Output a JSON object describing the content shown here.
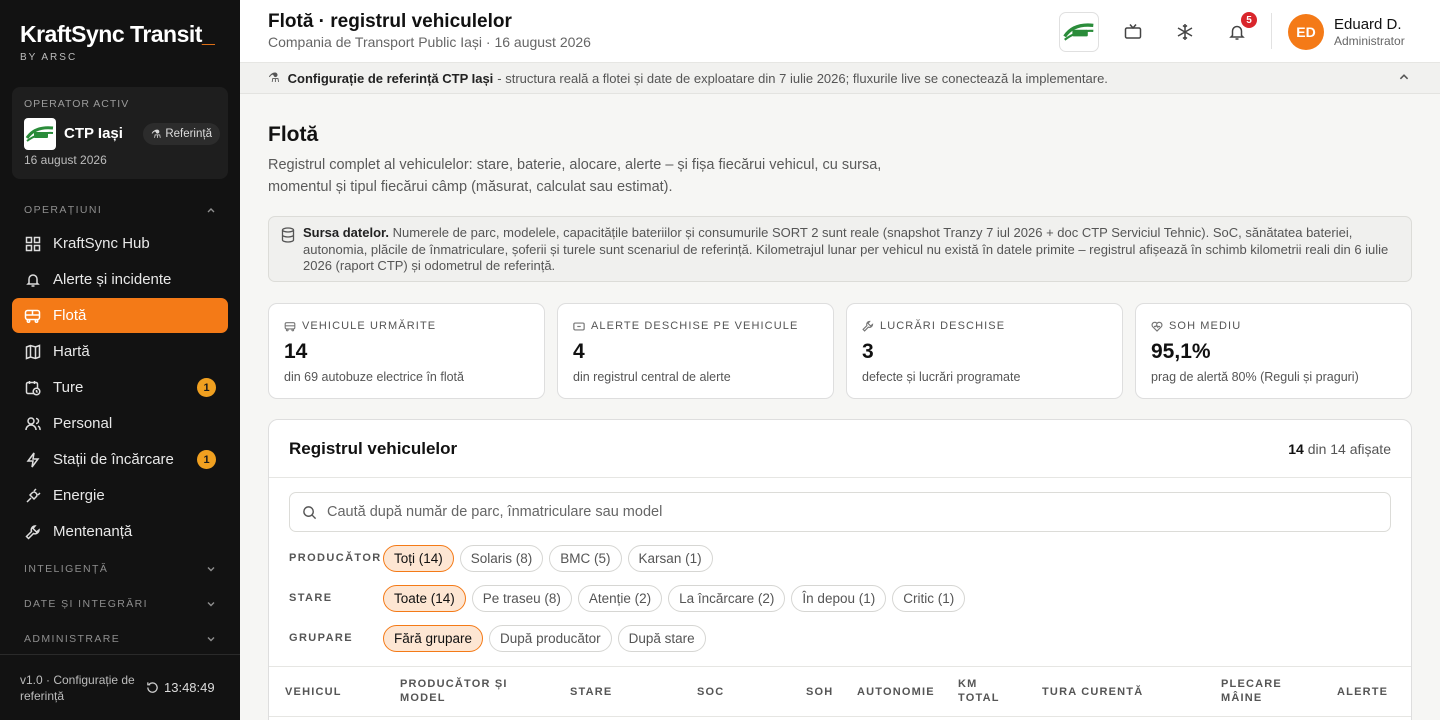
{
  "brand": {
    "name": "KraftSync Transit",
    "cursor": "_",
    "sub": "BY ARSC"
  },
  "operator": {
    "label": "OPERATOR ACTIV",
    "name": "CTP Iași",
    "badge": "Referință",
    "date": "16 august 2026"
  },
  "sidebar": {
    "section_operations": "OPERAȚIUNI",
    "items": [
      {
        "label": "KraftSync Hub",
        "icon": "grid-icon"
      },
      {
        "label": "Alerte și incidente",
        "icon": "bell-icon"
      },
      {
        "label": "Flotă",
        "icon": "bus-icon",
        "active": true
      },
      {
        "label": "Hartă",
        "icon": "map-icon"
      },
      {
        "label": "Ture",
        "icon": "clock-calendar-icon",
        "badge": "1"
      },
      {
        "label": "Personal",
        "icon": "users-icon"
      },
      {
        "label": "Stații de încărcare",
        "icon": "bolt-icon",
        "badge": "1"
      },
      {
        "label": "Energie",
        "icon": "plug-icon"
      },
      {
        "label": "Mentenanță",
        "icon": "wrench-icon"
      }
    ],
    "section_intelligence": "INTELIGENȚĂ",
    "section_data": "DATE ȘI INTEGRĂRI",
    "section_admin": "ADMINISTRARE",
    "footer_version": "v1.0 · Configurație de referință",
    "footer_time": "13:48:49"
  },
  "header": {
    "title": "Flotă · registrul vehiculelor",
    "subtitle": "Compania de Transport Public Iași · 16 august 2026",
    "notifications": "5",
    "avatar": "ED",
    "user_name": "Eduard D.",
    "user_role": "Administrator"
  },
  "banner": {
    "bold": "Configurație de referință CTP Iași",
    "text": "- structura reală a flotei și date de exploatare din 7 iulie 2026; fluxurile live se conectează la implementare."
  },
  "main": {
    "title": "Flotă",
    "description": "Registrul complet al vehiculelor: stare, baterie, alocare, alerte – și fișa fiecărui vehicul, cu sursa, momentul și tipul fiecărui câmp (măsurat, calculat sau estimat).",
    "source_bold": "Sursa datelor.",
    "source_text": "Numerele de parc, modelele, capacitățile bateriilor și consumurile SORT 2 sunt reale (snapshot Tranzy 7 iul 2026 + doc CTP Serviciul Tehnic). SoC, sănătatea bateriei, autonomia, plăcile de înmatriculare, șoferii și turele sunt scenariul de referință. Kilometrajul lunar per vehicul nu există în datele primite – registrul afișează în schimb kilometrii reali din 6 iulie 2026 (raport CTP) și odometrul de referință."
  },
  "kpis": [
    {
      "label": "VEHICULE URMĂRITE",
      "value": "14",
      "sub": "din 69 autobuze electrice în flotă",
      "icon": "bus-icon"
    },
    {
      "label": "ALERTE DESCHISE PE VEHICULE",
      "value": "4",
      "sub": "din registrul central de alerte",
      "icon": "alert-tag-icon"
    },
    {
      "label": "LUCRĂRI DESCHISE",
      "value": "3",
      "sub": "defecte și lucrări programate",
      "icon": "wrench-icon"
    },
    {
      "label": "SOH MEDIU",
      "value": "95,1%",
      "sub": "prag de alertă 80% (Reguli și praguri)",
      "icon": "heart-pulse-icon"
    }
  ],
  "registry": {
    "title": "Registrul vehiculelor",
    "count_bold": "14",
    "count_rest": "din 14 afișate",
    "search_placeholder": "Caută după număr de parc, înmatriculare sau model",
    "filters": [
      {
        "label": "PRODUCĂTOR",
        "chips": [
          "Toți (14)",
          "Solaris (8)",
          "BMC (5)",
          "Karsan (1)"
        ],
        "active": 0
      },
      {
        "label": "STARE",
        "chips": [
          "Toate (14)",
          "Pe traseu (8)",
          "Atenție (2)",
          "La încărcare (2)",
          "În depou (1)",
          "Critic (1)"
        ],
        "active": 0
      },
      {
        "label": "GRUPARE",
        "chips": [
          "Fără grupare",
          "După producător",
          "După stare"
        ],
        "active": 0
      }
    ],
    "columns": [
      "VEHICUL",
      "PRODUCĂTOR ȘI MODEL",
      "STARE",
      "SOC",
      "SOH",
      "AUTONOMIE",
      "KM TOTAL",
      "TURA CURENTĂ",
      "PLECARE MÂINE",
      "ALERTE"
    ]
  },
  "colors": {
    "accent": "#f47a17",
    "sidebar_bg": "#121212",
    "badge": "#f0a020",
    "notification": "#d9262c"
  }
}
